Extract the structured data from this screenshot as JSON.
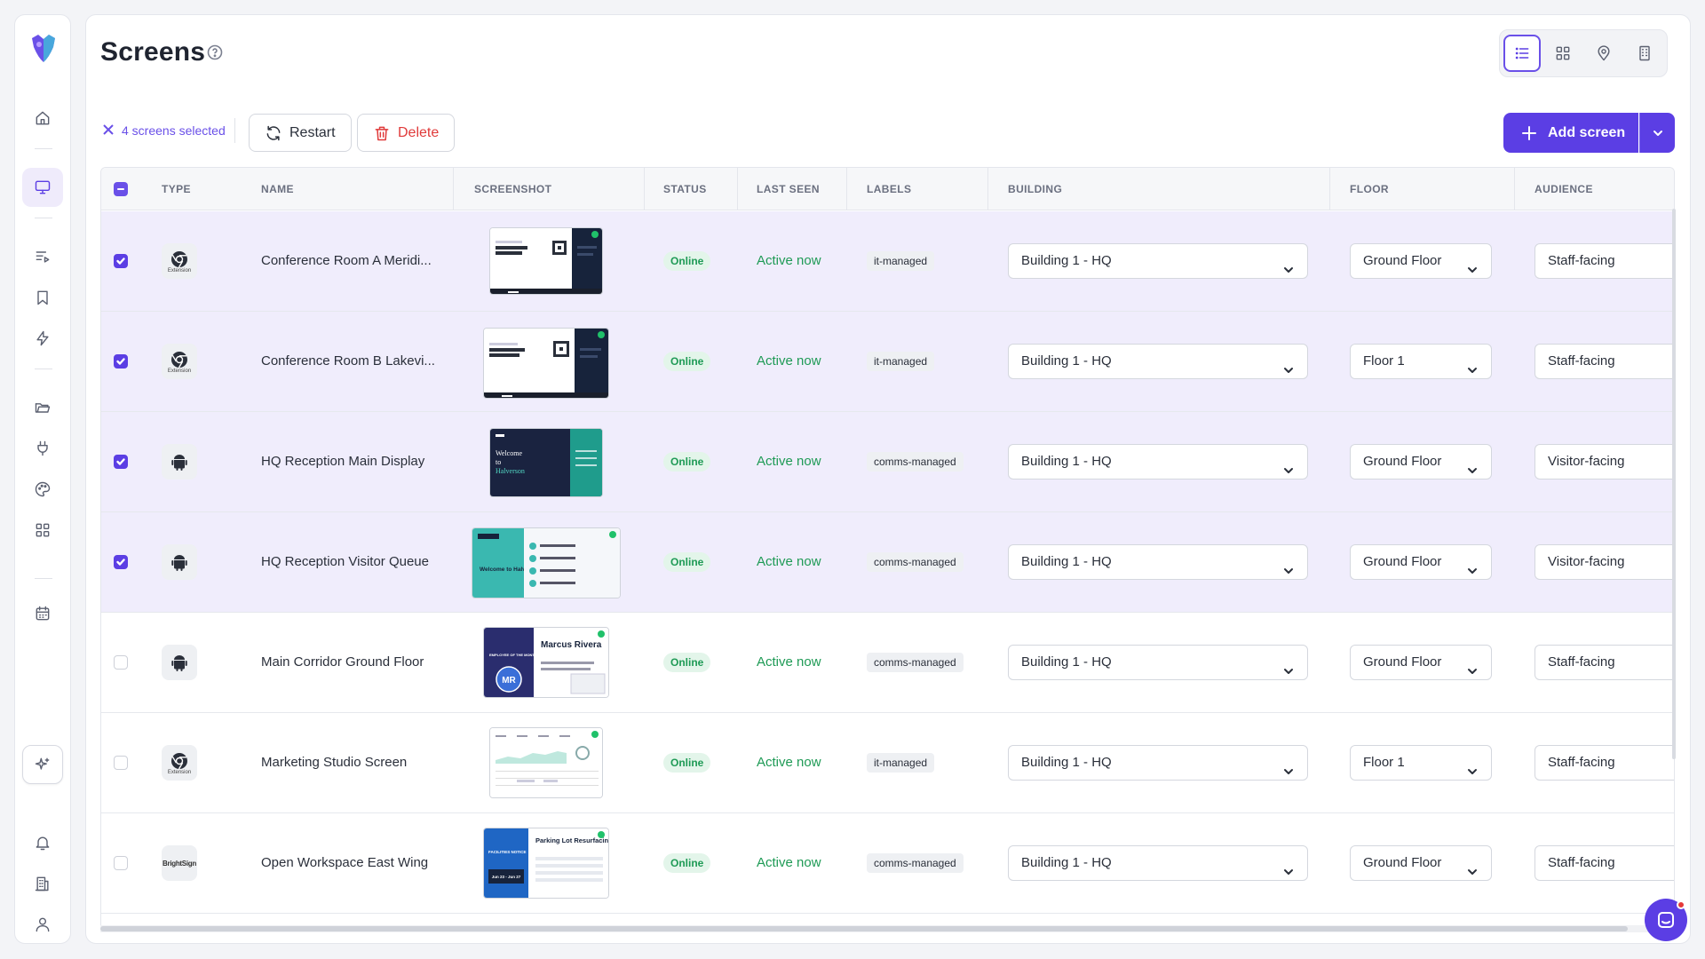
{
  "page": {
    "title": "Screens",
    "help_icon": "question-circle-icon"
  },
  "sidebar": {
    "logo": "brand-heart-logo",
    "items": [
      {
        "icon": "home-icon",
        "active": false
      },
      {
        "icon": "monitor-icon",
        "active": true
      },
      {
        "icon": "playlist-icon",
        "active": false
      },
      {
        "icon": "bookmark-icon",
        "active": false
      },
      {
        "icon": "lightning-icon",
        "active": false
      },
      {
        "icon": "folder-icon",
        "active": false
      },
      {
        "icon": "plug-icon",
        "active": false
      },
      {
        "icon": "palette-icon",
        "active": false
      },
      {
        "icon": "apps-grid-icon",
        "active": false
      },
      {
        "icon": "calendar-icon",
        "active": false
      },
      {
        "icon": "sparkle-icon",
        "active": false
      },
      {
        "icon": "bell-icon",
        "active": false
      },
      {
        "icon": "building-icon",
        "active": false
      },
      {
        "icon": "user-icon",
        "active": false
      }
    ]
  },
  "view_toggle": [
    {
      "icon": "list-view-icon",
      "active": true
    },
    {
      "icon": "grid-view-icon",
      "active": false
    },
    {
      "icon": "map-pin-icon",
      "active": false
    },
    {
      "icon": "building-view-icon",
      "active": false
    }
  ],
  "toolbar": {
    "selection_text": "4 screens selected",
    "restart_label": "Restart",
    "delete_label": "Delete",
    "add_screen_label": "Add screen"
  },
  "colors": {
    "accent": "#5b3ee4",
    "online_green": "#1e9a55",
    "danger": "#e03a3a",
    "selected_row": "#f0edfc"
  },
  "table": {
    "columns": [
      "TYPE",
      "NAME",
      "SCREENSHOT",
      "STATUS",
      "LAST SEEN",
      "LABELS",
      "BUILDING",
      "FLOOR",
      "AUDIENCE"
    ],
    "rows": [
      {
        "checked": true,
        "type": "chrome-extension",
        "type_caption": "Extension",
        "name": "Conference Room A Meridi...",
        "shot": "meeting-room",
        "status": "Online",
        "last_seen": "Active now",
        "label": "it-managed",
        "building": "Building 1 - HQ",
        "floor": "Ground Floor",
        "audience": "Staff-facing"
      },
      {
        "checked": true,
        "type": "chrome-extension",
        "type_caption": "Extension",
        "name": "Conference Room B Lakevi...",
        "shot": "meeting-room",
        "status": "Online",
        "last_seen": "Active now",
        "label": "it-managed",
        "building": "Building 1 - HQ",
        "floor": "Floor 1",
        "audience": "Staff-facing"
      },
      {
        "checked": true,
        "type": "android",
        "type_caption": "",
        "name": "HQ Reception Main Display",
        "shot": "welcome-dark",
        "status": "Online",
        "last_seen": "Active now",
        "label": "comms-managed",
        "building": "Building 1 - HQ",
        "floor": "Ground Floor",
        "audience": "Visitor-facing"
      },
      {
        "checked": true,
        "type": "android",
        "type_caption": "",
        "name": "HQ Reception Visitor Queue",
        "shot": "welcome-teal",
        "status": "Online",
        "last_seen": "Active now",
        "label": "comms-managed",
        "building": "Building 1 - HQ",
        "floor": "Ground Floor",
        "audience": "Visitor-facing"
      },
      {
        "checked": false,
        "type": "android",
        "type_caption": "",
        "name": "Main Corridor Ground Floor",
        "shot": "employee",
        "status": "Online",
        "last_seen": "Active now",
        "label": "comms-managed",
        "building": "Building 1 - HQ",
        "floor": "Ground Floor",
        "audience": "Staff-facing"
      },
      {
        "checked": false,
        "type": "chrome-extension",
        "type_caption": "Extension",
        "name": "Marketing Studio Screen",
        "shot": "dashboard",
        "status": "Online",
        "last_seen": "Active now",
        "label": "it-managed",
        "building": "Building 1 - HQ",
        "floor": "Floor 1",
        "audience": "Staff-facing"
      },
      {
        "checked": false,
        "type": "brightsign",
        "type_caption": "BrightSign",
        "name": "Open Workspace East Wing",
        "shot": "facilities",
        "status": "Online",
        "last_seen": "Active now",
        "label": "comms-managed",
        "building": "Building 1 - HQ",
        "floor": "Ground Floor",
        "audience": "Staff-facing"
      }
    ]
  },
  "thumbnails": {
    "welcome_dark": {
      "line1": "Welcome",
      "line2": "to",
      "line3": "Halverson"
    },
    "welcome_teal": {
      "text": "Welcome to Halverson & Co."
    },
    "employee": {
      "badge": "EMPLOYEE OF THE MONTH",
      "name": "Marcus Rivera",
      "initials": "MR"
    },
    "facilities": {
      "badge": "FACILITIES NOTICE",
      "title": "Parking Lot Resurfacing",
      "dates": "Jun 23 - Jun 27"
    }
  }
}
